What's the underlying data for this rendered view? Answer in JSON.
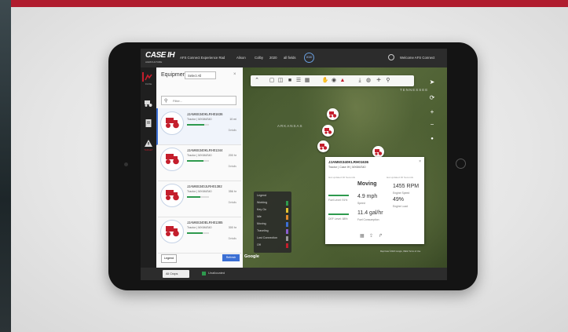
{
  "app": {
    "logo": "CASE IH",
    "logo_sub": "AGRICULTURE"
  },
  "nav": {
    "org": "AFS Connect Experience Rad",
    "state": "Alison",
    "county": "Colby",
    "year": "2020",
    "fields": "all fields",
    "year_badge": "2020",
    "welcome": "Welcome AFS Connect"
  },
  "panel": {
    "title": "Equipment",
    "select_label": "Select All",
    "filter_placeholder": "Filter...",
    "legend_label": "Legend",
    "refresh_label": "Refresh",
    "items": [
      {
        "id": "JJAM6S340KLRH01636",
        "model": "Tractor | MX6M/340",
        "speed": "10 mi",
        "status": "Details",
        "fuel": 0.8
      },
      {
        "id": "JJAM6S340KLRH01344",
        "model": "Tractor | MX6M/340",
        "speed": "200 hr",
        "status": "Details",
        "fuel": 0.75
      },
      {
        "id": "JJAM6S340JLRH01382",
        "model": "Tractor | MX6M/340",
        "speed": "356 hr",
        "status": "Details",
        "fuel": 0.6
      },
      {
        "id": "JJAM6S340ELRH01385",
        "model": "Tractor | MX6M/340",
        "speed": "300 hr",
        "status": "Details",
        "fuel": 0.7
      }
    ]
  },
  "sidebar": {
    "labels": [
      "RAISE",
      "",
      "",
      "TARGET"
    ]
  },
  "map": {
    "labels": [
      "ARKANSAS",
      "TENNESSEE"
    ],
    "google": "Google",
    "attribution": "Map Data ©2020 Google, INEGI  Terms of Use",
    "legend": {
      "title": "Legend",
      "rows": [
        {
          "label": "Working",
          "color": "#2e9a4e"
        },
        {
          "label": "Key On",
          "color": "#e3c233"
        },
        {
          "label": "Idle",
          "color": "#e08a2c"
        },
        {
          "label": "Moving",
          "color": "#3b6fd4"
        },
        {
          "label": "Traveling",
          "color": "#8a5fd0"
        },
        {
          "label": "Lost Connection",
          "color": "#9a9a9a"
        },
        {
          "label": "Off",
          "color": "#c41e2c"
        }
      ]
    }
  },
  "popup": {
    "id": "JJAM6S340KLRH01636",
    "subtitle": "Tractor | Case IH | MX6M/340",
    "updated_left": "last updated 40 Seconds",
    "updated_right": "last updated 40 Seconds",
    "state": "Moving",
    "speed_value": "4.9 mph",
    "speed_label": "Speed",
    "fuel_cons_value": "11.4 gal/hr",
    "fuel_cons_label": "Fuel Consumption",
    "rpm_value": "1455 RPM",
    "rpm_label": "Engine Speed",
    "load_value": "49%",
    "load_label": "Engine Load",
    "fuel_level": "Fuel Level: 91%",
    "def_level": "DEF Level: 88%"
  },
  "bottom": {
    "crops_label": "All Crops",
    "unallocated": "Unallocated"
  },
  "colors": {
    "brand": "#b01c2e",
    "accent": "#3b6fd4",
    "working": "#2e9a4e"
  }
}
